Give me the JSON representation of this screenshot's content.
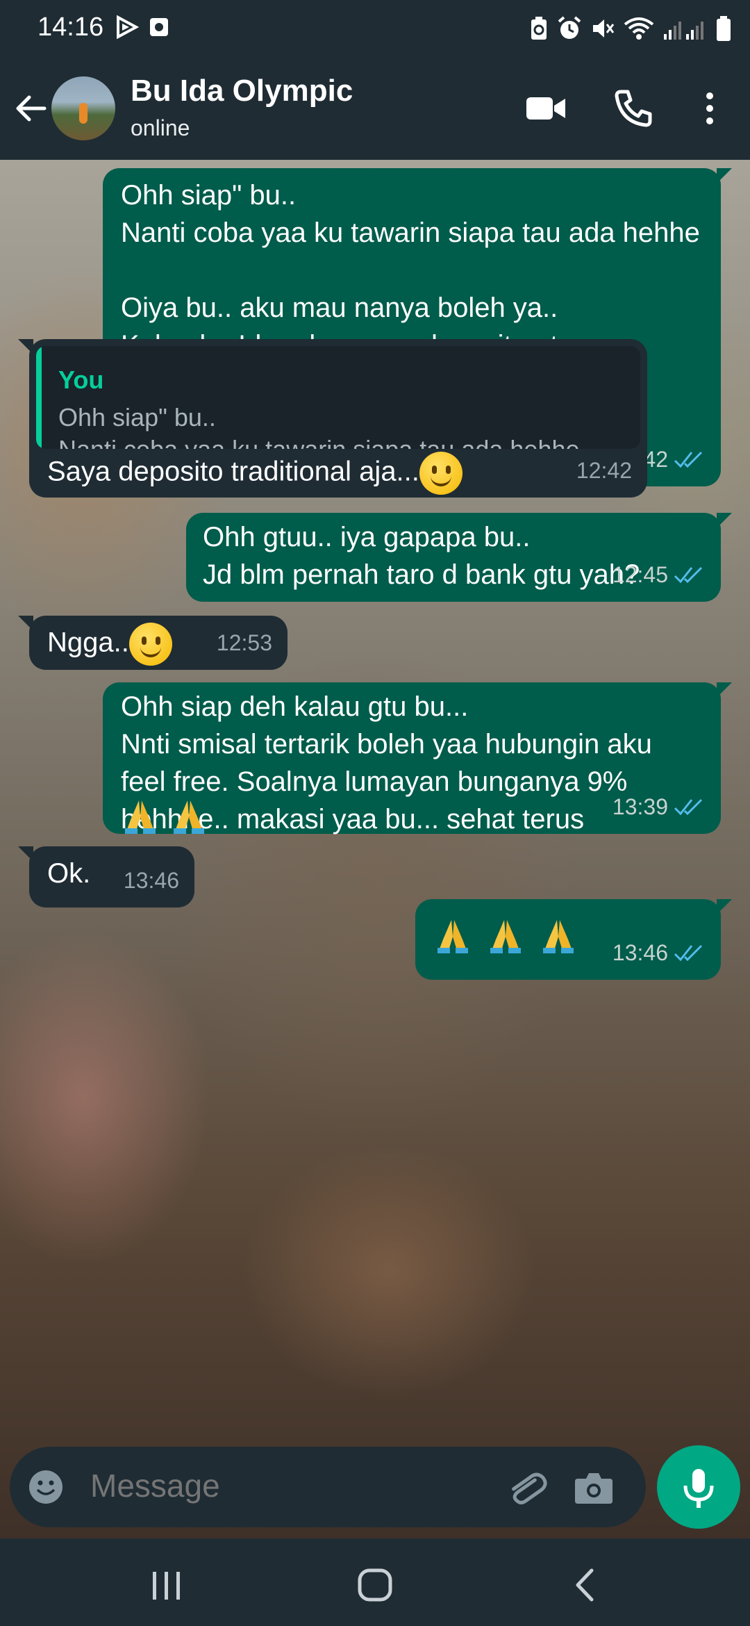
{
  "status_bar": {
    "time": "14:16"
  },
  "header": {
    "contact_name": "Bu Ida Olympic",
    "status": "online"
  },
  "messages": [
    {
      "direction": "out",
      "text": "Ohh siap\" bu..\nNanti coba yaa ku tawarin siapa tau ada hehhe\n\nOiya bu.. aku mau nanya boleh ya..\nKalau bu Ida uda punya deposito atau tabungan berjangka gtu belum bu?",
      "time": "12:42"
    },
    {
      "direction": "in",
      "quote_author": "You",
      "quote_text": "Ohh siap\" bu..\nNanti coba yaa ku tawarin siapa tau ada hehhe...",
      "text": "Saya deposito traditional aja...",
      "time": "12:42"
    },
    {
      "direction": "out",
      "text": "Ohh gtuu.. iya gapapa bu..\nJd blm pernah taro d bank gtu yah?",
      "time": "12:45"
    },
    {
      "direction": "in",
      "text": "Ngga..",
      "time": "12:53"
    },
    {
      "direction": "out",
      "text": "Ohh siap deh kalau gtu bu...\nNnti smisal tertarik boleh yaa hubungin aku feel free. Soalnya lumayan bunganya 9% hehhhe.. makasi yaa bu... sehat terus",
      "time": "13:39"
    },
    {
      "direction": "in",
      "text": "Ok.",
      "time": "13:46"
    },
    {
      "direction": "out",
      "text": "",
      "time": "13:46"
    }
  ],
  "input": {
    "placeholder": "Message"
  },
  "colors": {
    "outgoing_bubble": "#005c4b",
    "incoming_bubble": "#1f2c34",
    "accent": "#00a884",
    "read_ticks": "#53bdeb"
  },
  "icons": {
    "status_bar": [
      "play-icon",
      "camera-notification-icon",
      "battery-saver-icon",
      "alarm-icon",
      "mute-icon",
      "wifi-icon",
      "signal-icon",
      "battery-icon"
    ],
    "header": [
      "back-arrow-icon",
      "video-call-icon",
      "voice-call-icon",
      "more-options-icon"
    ],
    "input": [
      "emoji-icon",
      "attach-icon",
      "camera-icon",
      "mic-icon"
    ],
    "navigation": [
      "recent-apps-icon",
      "home-icon",
      "back-icon"
    ],
    "emoji_in_messages": [
      "smiling-face-emoji",
      "folded-hands-emoji"
    ]
  }
}
